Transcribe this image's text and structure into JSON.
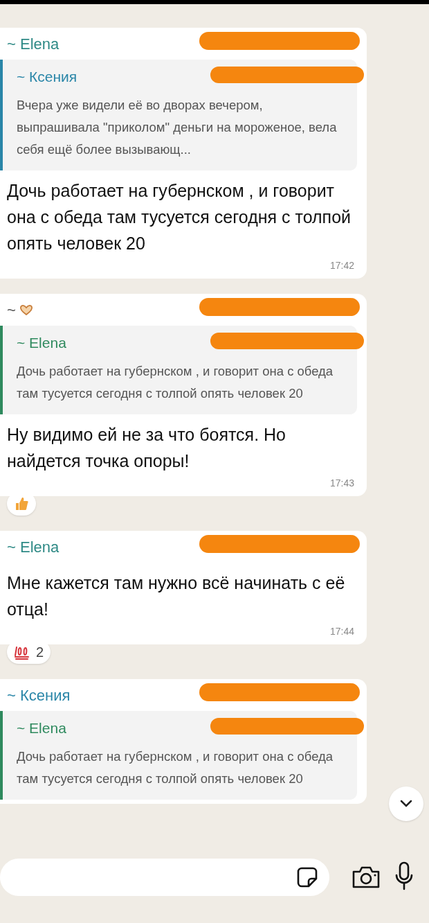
{
  "messages": [
    {
      "sender": {
        "name": "~ Elena",
        "color": "#2f8a86",
        "icon": false,
        "redacted": true
      },
      "quote": {
        "name": "~ Ксения",
        "color": "#2a86a8",
        "redacted": true,
        "text": "Вчера уже видели её во дворах вечером, выпрашивала \"приколом\" деньги на мороженое, вела себя ещё более вызывающ..."
      },
      "body": "Дочь работает на губернском , и говорит она с обеда там тусуется сегодня с толпой опять человек 20",
      "time": "17:42"
    },
    {
      "sender": {
        "name": "~",
        "color": "#555555",
        "icon": true,
        "redacted": true
      },
      "quote": {
        "name": "~ Elena",
        "color": "#2f8a5e",
        "redacted": true,
        "text": "Дочь работает на губернском , и говорит она с обеда там тусуется сегодня с толпой опять человек 20"
      },
      "body": "Ну видимо ей не за что боятся. Но найдется точка опоры!",
      "time": "17:43",
      "reaction": {
        "kind": "thumbs"
      }
    },
    {
      "sender": {
        "name": "~ Elena",
        "color": "#2f8a86",
        "icon": false,
        "redacted": true
      },
      "body": "Мне кажется там нужно всё начинать с её отца!",
      "time": "17:44",
      "reaction": {
        "kind": "hundred",
        "count": "2"
      }
    },
    {
      "sender": {
        "name": "~ Ксения",
        "color": "#2a86a8",
        "icon": false,
        "redacted": true
      },
      "quote": {
        "name": "~ Elena",
        "color": "#2f8a5e",
        "redacted": true,
        "text": "Дочь работает на губернском , и говорит она с обеда там тусуется сегодня с толпой опять человек 20"
      }
    }
  ]
}
